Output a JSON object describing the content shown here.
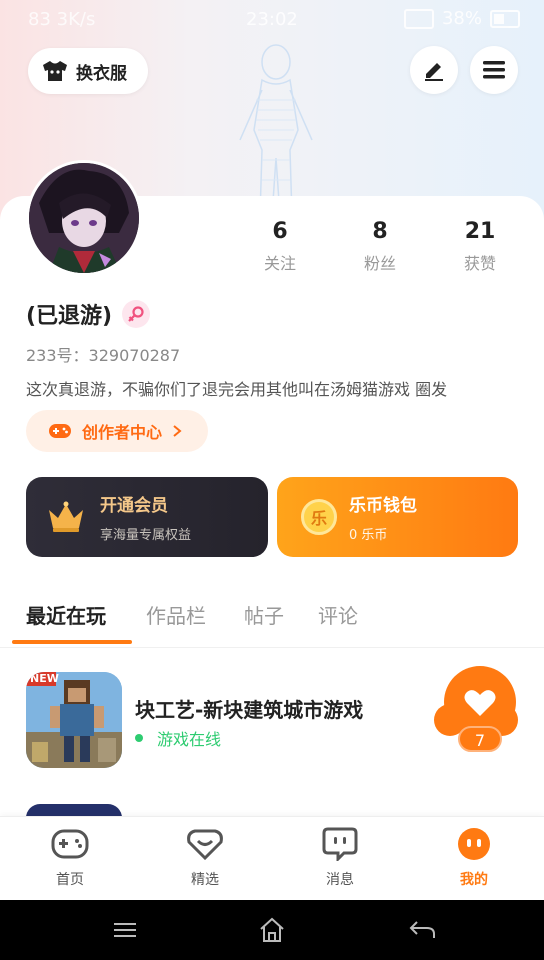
{
  "status_bar": {
    "left": "83 3K/s",
    "time": "23:02",
    "battery": "38%"
  },
  "header": {
    "dress_up_label": "换衣服"
  },
  "profile": {
    "stats": [
      {
        "value": "6",
        "label": "关注"
      },
      {
        "value": "8",
        "label": "粉丝"
      },
      {
        "value": "21",
        "label": "获赞"
      }
    ],
    "name": "(已退游)",
    "uid": "233号：329070287",
    "bio": "这次真退游，不骗你们了退完会用其他叫在汤姆猫游戏 圈发",
    "creator_center": "创作者中心"
  },
  "promos": {
    "vip": {
      "title": "开通会员",
      "subtitle": "享海量专属权益"
    },
    "wallet": {
      "title": "乐币钱包",
      "subtitle": "0 乐币",
      "coin_char": "乐"
    }
  },
  "tabs": [
    "最近在玩",
    "作品栏",
    "帖子",
    "评论"
  ],
  "recent_game": {
    "title": "块工艺-新块建筑城市游戏",
    "status": "游戏在线",
    "likes": "7",
    "icon_badge": "NEW"
  },
  "nav": [
    {
      "label": "首页"
    },
    {
      "label": "精选"
    },
    {
      "label": "消息"
    },
    {
      "label": "我的"
    }
  ],
  "colors": {
    "accent": "#ff7a12",
    "online": "#2ecc71"
  }
}
